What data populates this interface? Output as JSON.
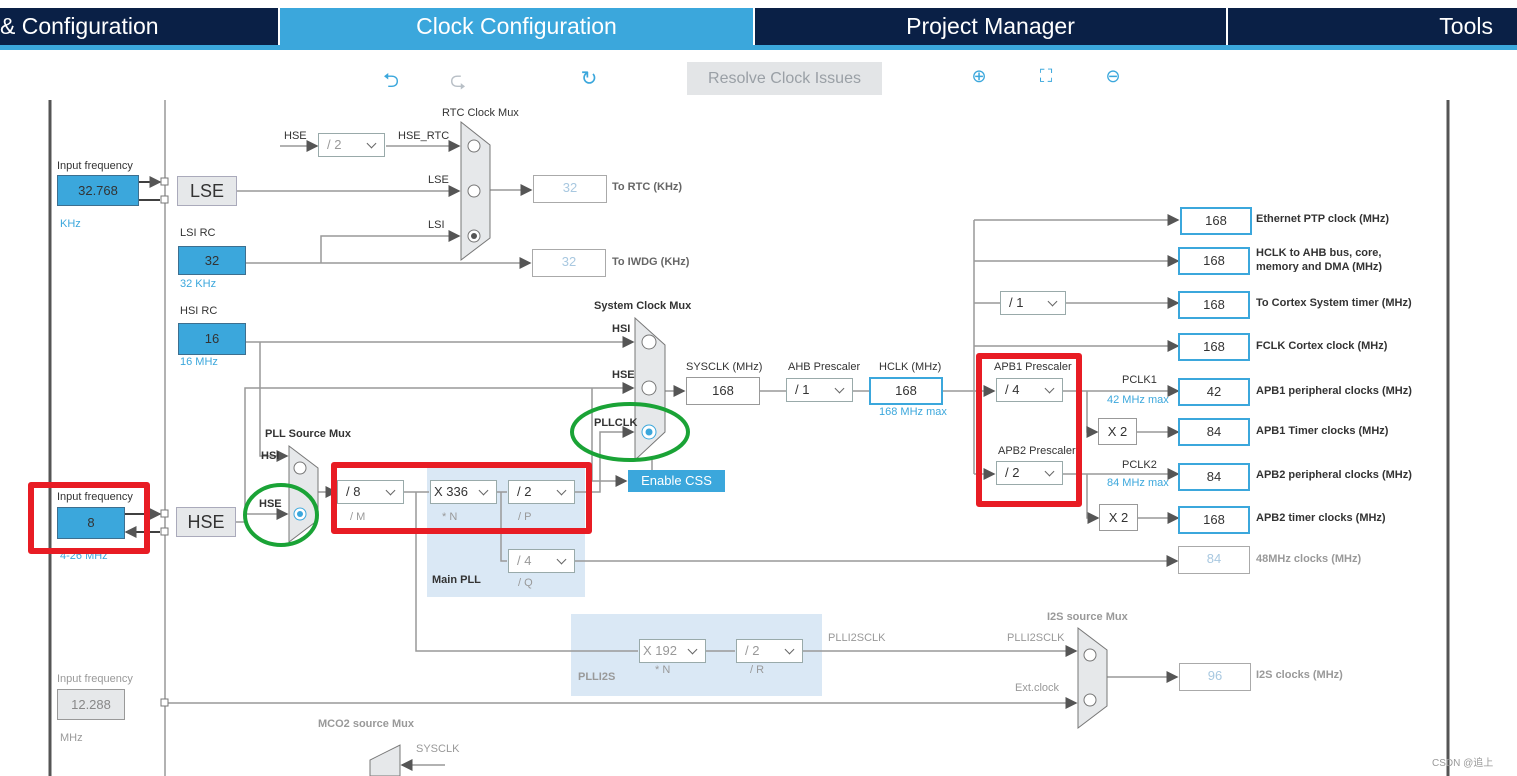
{
  "tabs": [
    {
      "label": "& Configuration"
    },
    {
      "label": "Clock Configuration",
      "active": true
    },
    {
      "label": "Project Manager"
    },
    {
      "label": "Tools"
    }
  ],
  "toolbar": {
    "undo_icon": "undo-icon",
    "redo_icon": "redo-icon",
    "refresh_icon": "refresh-icon",
    "resolve_label": "Resolve Clock Issues",
    "zoom_in_icon": "zoom-in-icon",
    "fit_icon": "fit-screen-icon",
    "zoom_out_icon": "zoom-out-icon"
  },
  "lse": {
    "input_label": "Input frequency",
    "value": "32.768",
    "unit": "KHz",
    "name": "LSE"
  },
  "lsi": {
    "label": "LSI RC",
    "value": "32",
    "unit": "32 KHz"
  },
  "hsi": {
    "label": "HSI RC",
    "value": "16",
    "unit": "16 MHz"
  },
  "hse": {
    "input_label": "Input frequency",
    "value": "8",
    "range": "4-26 MHz",
    "name": "HSE"
  },
  "ext": {
    "input_label": "Input frequency",
    "value": "12.288",
    "unit": "MHz"
  },
  "rtc": {
    "mux_label": "RTC Clock Mux",
    "hse_label": "HSE",
    "div": "/ 2",
    "hse_rtc": "HSE_RTC",
    "lse": "LSE",
    "lsi": "LSI",
    "rtc_value": "32",
    "rtc_label": "To RTC (KHz)",
    "iwdg_value": "32",
    "iwdg_label": "To IWDG (KHz)"
  },
  "sysmux": {
    "label": "System Clock Mux",
    "hsi": "HSI",
    "hse": "HSE",
    "pllclk": "PLLCLK",
    "selected": "PLLCLK"
  },
  "pllmux": {
    "label": "PLL Source Mux",
    "hsi": "HSI",
    "hse": "HSE",
    "selected": "HSE"
  },
  "pll": {
    "label": "Main PLL",
    "m": "/ 8",
    "m_label": "/ M",
    "n": "X 336",
    "n_label": "* N",
    "p": "/ 2",
    "p_label": "/ P",
    "q": "/ 4",
    "q_label": "/ Q"
  },
  "enable_css": "Enable CSS",
  "sysclk": {
    "label": "SYSCLK (MHz)",
    "value": "168"
  },
  "ahb": {
    "label": "AHB Prescaler",
    "value": "/ 1"
  },
  "hclk": {
    "label": "HCLK (MHz)",
    "value": "168",
    "max": "168 MHz max"
  },
  "cortex_div": "/ 1",
  "apb1": {
    "label": "APB1 Prescaler",
    "value": "/ 4",
    "pclk": "PCLK1",
    "max": "42 MHz max",
    "x2": "X 2"
  },
  "apb2": {
    "label": "APB2 Prescaler",
    "value": "/ 2",
    "pclk": "PCLK2",
    "max": "84 MHz max",
    "x2": "X 2"
  },
  "outputs": [
    {
      "value": "168",
      "label": "Ethernet PTP clock (MHz)"
    },
    {
      "value": "168",
      "label": "HCLK to AHB bus, core, memory and DMA (MHz)"
    },
    {
      "value": "168",
      "label": "To Cortex System timer (MHz)"
    },
    {
      "value": "168",
      "label": "FCLK Cortex clock (MHz)"
    },
    {
      "value": "42",
      "label": "APB1 peripheral clocks (MHz)"
    },
    {
      "value": "84",
      "label": "APB1 Timer clocks (MHz)"
    },
    {
      "value": "84",
      "label": "APB2 peripheral clocks (MHz)"
    },
    {
      "value": "168",
      "label": "APB2 timer clocks (MHz)"
    },
    {
      "value": "84",
      "label": "48MHz clocks (MHz)"
    }
  ],
  "plli2s": {
    "label": "PLLI2S",
    "n": "X 192",
    "n_label": "* N",
    "r": "/ 2",
    "r_label": "/ R",
    "out": "PLLI2SCLK"
  },
  "i2s": {
    "mux_label": "I2S source Mux",
    "plli2sclk": "PLLI2SCLK",
    "ext": "Ext.clock",
    "value": "96",
    "label": "I2S clocks (MHz)"
  },
  "mco2": {
    "label": "MCO2 source Mux",
    "sysclk": "SYSCLK"
  },
  "watermark": "CSDN @追上",
  "colors": {
    "accent": "#3ba7dc",
    "nav": "#0a2046",
    "annotation_red": "#e81c24",
    "annotation_green": "#1aa336"
  }
}
